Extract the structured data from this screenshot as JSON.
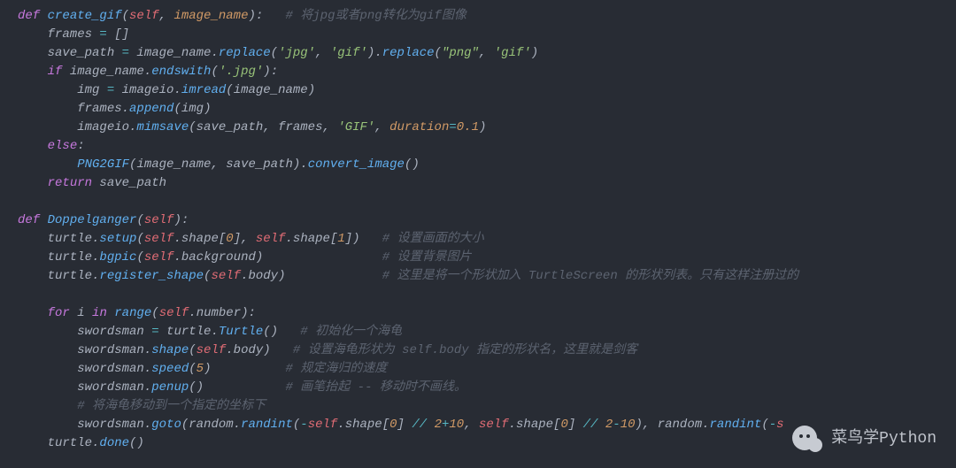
{
  "code_tokens": [
    [
      [
        "kw",
        "def "
      ],
      [
        "fn",
        "create_gif"
      ],
      [
        "punc",
        "("
      ],
      [
        "self",
        "self"
      ],
      [
        "punc",
        ", "
      ],
      [
        "param",
        "image_name"
      ],
      [
        "punc",
        "):   "
      ],
      [
        "cmt",
        "# 将jpg或者png转化为gif图像"
      ]
    ],
    [
      [
        "id",
        "    frames "
      ],
      [
        "op",
        "="
      ],
      [
        "id",
        " []"
      ]
    ],
    [
      [
        "id",
        "    save_path "
      ],
      [
        "op",
        "="
      ],
      [
        "id",
        " image_name."
      ],
      [
        "fn",
        "replace"
      ],
      [
        "punc",
        "("
      ],
      [
        "str",
        "'jpg'"
      ],
      [
        "punc",
        ", "
      ],
      [
        "str",
        "'gif'"
      ],
      [
        "punc",
        ")."
      ],
      [
        "fn",
        "replace"
      ],
      [
        "punc",
        "("
      ],
      [
        "str",
        "\"png\""
      ],
      [
        "punc",
        ", "
      ],
      [
        "str",
        "'gif'"
      ],
      [
        "punc",
        ")"
      ]
    ],
    [
      [
        "id",
        "    "
      ],
      [
        "kw",
        "if"
      ],
      [
        "id",
        " image_name."
      ],
      [
        "fn",
        "endswith"
      ],
      [
        "punc",
        "("
      ],
      [
        "str",
        "'.jpg'"
      ],
      [
        "punc",
        "):"
      ]
    ],
    [
      [
        "id",
        "        img "
      ],
      [
        "op",
        "="
      ],
      [
        "id",
        " imageio."
      ],
      [
        "fn",
        "imread"
      ],
      [
        "punc",
        "("
      ],
      [
        "id",
        "image_name"
      ],
      [
        "punc",
        ")"
      ]
    ],
    [
      [
        "id",
        "        frames."
      ],
      [
        "fn",
        "append"
      ],
      [
        "punc",
        "("
      ],
      [
        "id",
        "img"
      ],
      [
        "punc",
        ")"
      ]
    ],
    [
      [
        "id",
        "        imageio."
      ],
      [
        "fn",
        "mimsave"
      ],
      [
        "punc",
        "("
      ],
      [
        "id",
        "save_path"
      ],
      [
        "punc",
        ", "
      ],
      [
        "id",
        "frames"
      ],
      [
        "punc",
        ", "
      ],
      [
        "str",
        "'GIF'"
      ],
      [
        "punc",
        ", "
      ],
      [
        "param",
        "duration"
      ],
      [
        "op",
        "="
      ],
      [
        "num",
        "0.1"
      ],
      [
        "punc",
        ")"
      ]
    ],
    [
      [
        "id",
        "    "
      ],
      [
        "kw",
        "else"
      ],
      [
        "punc",
        ":"
      ]
    ],
    [
      [
        "id",
        "        "
      ],
      [
        "fn",
        "PNG2GIF"
      ],
      [
        "punc",
        "("
      ],
      [
        "id",
        "image_name"
      ],
      [
        "punc",
        ", "
      ],
      [
        "id",
        "save_path"
      ],
      [
        "punc",
        ")."
      ],
      [
        "fn",
        "convert_image"
      ],
      [
        "punc",
        "()"
      ]
    ],
    [
      [
        "id",
        "    "
      ],
      [
        "kw",
        "return"
      ],
      [
        "id",
        " save_path"
      ]
    ],
    [
      [
        "id",
        ""
      ]
    ],
    [
      [
        "kw",
        "def "
      ],
      [
        "fn",
        "Doppelganger"
      ],
      [
        "punc",
        "("
      ],
      [
        "self",
        "self"
      ],
      [
        "punc",
        "):"
      ]
    ],
    [
      [
        "id",
        "    turtle."
      ],
      [
        "fn",
        "setup"
      ],
      [
        "punc",
        "("
      ],
      [
        "self",
        "self"
      ],
      [
        "punc",
        "."
      ],
      [
        "id",
        "shape"
      ],
      [
        "punc",
        "["
      ],
      [
        "num",
        "0"
      ],
      [
        "punc",
        "], "
      ],
      [
        "self",
        "self"
      ],
      [
        "punc",
        "."
      ],
      [
        "id",
        "shape"
      ],
      [
        "punc",
        "["
      ],
      [
        "num",
        "1"
      ],
      [
        "punc",
        "])   "
      ],
      [
        "cmt",
        "# 设置画面的大小"
      ]
    ],
    [
      [
        "id",
        "    turtle."
      ],
      [
        "fn",
        "bgpic"
      ],
      [
        "punc",
        "("
      ],
      [
        "self",
        "self"
      ],
      [
        "punc",
        "."
      ],
      [
        "id",
        "background"
      ],
      [
        "punc",
        ")                "
      ],
      [
        "cmt",
        "# 设置背景图片"
      ]
    ],
    [
      [
        "id",
        "    turtle."
      ],
      [
        "fn",
        "register_shape"
      ],
      [
        "punc",
        "("
      ],
      [
        "self",
        "self"
      ],
      [
        "punc",
        "."
      ],
      [
        "id",
        "body"
      ],
      [
        "punc",
        ")             "
      ],
      [
        "cmt",
        "# 这里是将一个形状加入 TurtleScreen 的形状列表。只有这样注册过的"
      ]
    ],
    [
      [
        "id",
        ""
      ]
    ],
    [
      [
        "id",
        "    "
      ],
      [
        "kw",
        "for"
      ],
      [
        "id",
        " i "
      ],
      [
        "kw",
        "in"
      ],
      [
        "id",
        " "
      ],
      [
        "fn",
        "range"
      ],
      [
        "punc",
        "("
      ],
      [
        "self",
        "self"
      ],
      [
        "punc",
        "."
      ],
      [
        "id",
        "number"
      ],
      [
        "punc",
        "):"
      ]
    ],
    [
      [
        "id",
        "        swordsman "
      ],
      [
        "op",
        "="
      ],
      [
        "id",
        " turtle."
      ],
      [
        "fn",
        "Turtle"
      ],
      [
        "punc",
        "()   "
      ],
      [
        "cmt",
        "# 初始化一个海龟"
      ]
    ],
    [
      [
        "id",
        "        swordsman."
      ],
      [
        "fn",
        "shape"
      ],
      [
        "punc",
        "("
      ],
      [
        "self",
        "self"
      ],
      [
        "punc",
        "."
      ],
      [
        "id",
        "body"
      ],
      [
        "punc",
        ")   "
      ],
      [
        "cmt",
        "# 设置海龟形状为 self.body 指定的形状名，这里就是剑客"
      ]
    ],
    [
      [
        "id",
        "        swordsman."
      ],
      [
        "fn",
        "speed"
      ],
      [
        "punc",
        "("
      ],
      [
        "num",
        "5"
      ],
      [
        "punc",
        ")          "
      ],
      [
        "cmt",
        "# 规定海归的速度"
      ]
    ],
    [
      [
        "id",
        "        swordsman."
      ],
      [
        "fn",
        "penup"
      ],
      [
        "punc",
        "()           "
      ],
      [
        "cmt",
        "# 画笔抬起 -- 移动时不画线。"
      ]
    ],
    [
      [
        "id",
        "        "
      ],
      [
        "cmt",
        "# 将海龟移动到一个指定的坐标下"
      ]
    ],
    [
      [
        "id",
        "        swordsman."
      ],
      [
        "fn",
        "goto"
      ],
      [
        "punc",
        "("
      ],
      [
        "id",
        "random."
      ],
      [
        "fn",
        "randint"
      ],
      [
        "punc",
        "("
      ],
      [
        "op",
        "-"
      ],
      [
        "self",
        "self"
      ],
      [
        "punc",
        "."
      ],
      [
        "id",
        "shape"
      ],
      [
        "punc",
        "["
      ],
      [
        "num",
        "0"
      ],
      [
        "punc",
        "] "
      ],
      [
        "op",
        "//"
      ],
      [
        "id",
        " "
      ],
      [
        "num",
        "2"
      ],
      [
        "op",
        "+"
      ],
      [
        "num",
        "10"
      ],
      [
        "punc",
        ", "
      ],
      [
        "self",
        "self"
      ],
      [
        "punc",
        "."
      ],
      [
        "id",
        "shape"
      ],
      [
        "punc",
        "["
      ],
      [
        "num",
        "0"
      ],
      [
        "punc",
        "] "
      ],
      [
        "op",
        "//"
      ],
      [
        "id",
        " "
      ],
      [
        "num",
        "2"
      ],
      [
        "op",
        "-"
      ],
      [
        "num",
        "10"
      ],
      [
        "punc",
        "), "
      ],
      [
        "id",
        "random."
      ],
      [
        "fn",
        "randint"
      ],
      [
        "punc",
        "("
      ],
      [
        "op",
        "-"
      ],
      [
        "self",
        "s"
      ]
    ],
    [
      [
        "id",
        "    turtle."
      ],
      [
        "fn",
        "done"
      ],
      [
        "punc",
        "()"
      ]
    ]
  ],
  "watermark": {
    "text": "菜鸟学Python",
    "icon": "wechat-icon"
  }
}
